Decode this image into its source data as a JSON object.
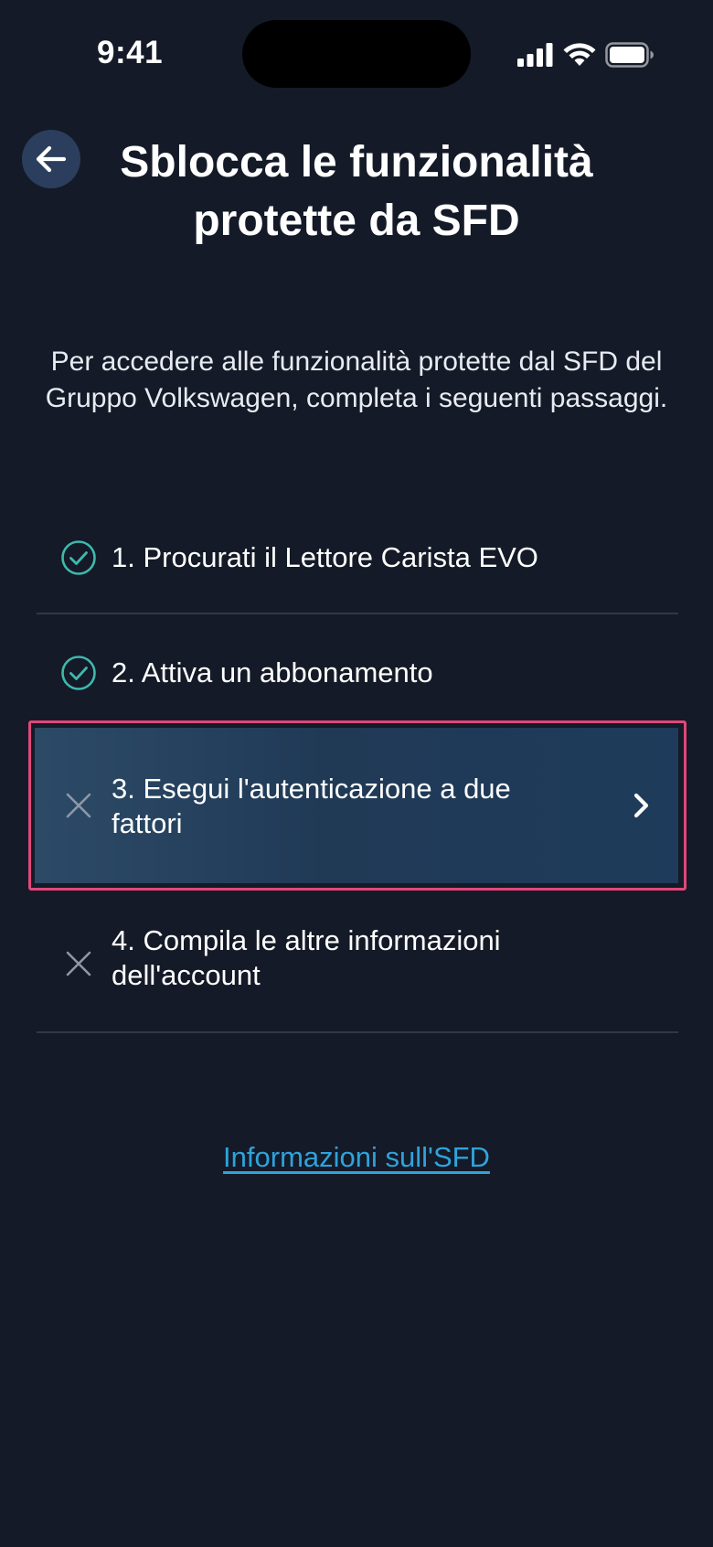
{
  "status_bar": {
    "time": "9:41",
    "icons": [
      "cellular-signal-icon",
      "wifi-icon",
      "battery-icon"
    ]
  },
  "header": {
    "back_icon": "arrow-left-icon",
    "title": "Sblocca le funzionalità protette da SFD"
  },
  "intro": "Per accedere alle funzionalità protette dal SFD del Gruppo Volkswagen, completa i seguenti passaggi.",
  "steps": [
    {
      "label": "1. Procurati il Lettore Carista EVO",
      "status": "completed",
      "icon": "check-circle-icon"
    },
    {
      "label": "2. Attiva un abbonamento",
      "status": "completed",
      "icon": "check-circle-icon"
    },
    {
      "label": "3. Esegui l'autenticazione a due fattori",
      "status": "pending",
      "icon": "close-x-icon",
      "action_icon": "chevron-right-icon"
    },
    {
      "label": "4. Compila le altre informazioni dell'account",
      "status": "pending",
      "icon": "close-x-icon"
    }
  ],
  "link": {
    "label": "Informazioni sull'SFD"
  },
  "colors": {
    "background": "#141a27",
    "check_accent": "#3fb8ad",
    "link": "#2ea3dc",
    "highlight_border": "#e0487a",
    "active_row": "#203a56"
  }
}
